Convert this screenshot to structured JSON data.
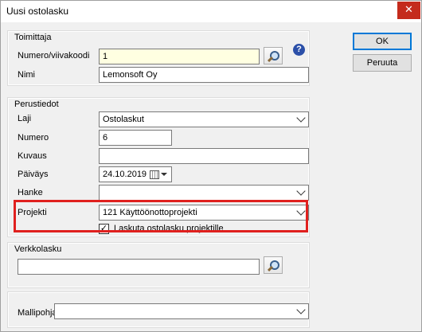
{
  "window": {
    "title": "Uusi ostolasku",
    "close_glyph": "✕"
  },
  "buttons": {
    "ok": "OK",
    "cancel": "Peruuta"
  },
  "toimittaja": {
    "title": "Toimittaja",
    "numero_label": "Numero/viivakoodi",
    "numero_value": "1",
    "nimi_label": "Nimi",
    "nimi_value": "Lemonsoft Oy",
    "help_glyph": "?"
  },
  "perustiedot": {
    "title": "Perustiedot",
    "laji_label": "Laji",
    "laji_value": "Ostolaskut",
    "numero_label": "Numero",
    "numero_value": "6",
    "kuvaus_label": "Kuvaus",
    "kuvaus_value": "",
    "paivays_label": "Päiväys",
    "paivays_value": "24.10.2019",
    "hanke_label": "Hanke",
    "hanke_value": "",
    "projekti_label": "Projekti",
    "projekti_value": "121 Käyttöönottoprojekti",
    "laskuta_label": "Laskuta ostolasku projektille",
    "laskuta_checked": true,
    "check_glyph": "✓"
  },
  "verkkolasku": {
    "title": "Verkkolasku",
    "value": ""
  },
  "mallipohja": {
    "label": "Mallipohja",
    "value": ""
  }
}
